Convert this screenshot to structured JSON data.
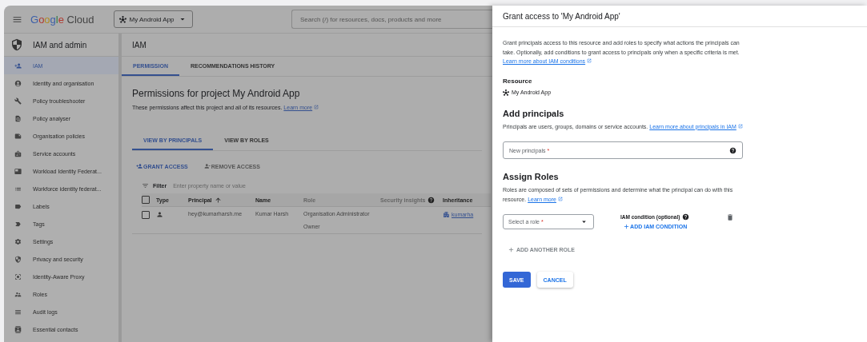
{
  "topbar": {
    "product": "Google Cloud",
    "project": "My Android App",
    "search": {
      "placeholder": "Search (/) for resources, docs, products and more"
    }
  },
  "sidebar": {
    "title": "IAM and admin",
    "items": [
      {
        "label": "IAM",
        "selected": true
      },
      {
        "label": "Identity and organisation",
        "selected": false
      },
      {
        "label": "Policy troubleshooter",
        "selected": false
      },
      {
        "label": "Policy analyser",
        "selected": false
      },
      {
        "label": "Organisation policies",
        "selected": false
      },
      {
        "label": "Service accounts",
        "selected": false
      },
      {
        "label": "Workload Identity Federat...",
        "selected": false
      },
      {
        "label": "Workforce identity federat...",
        "selected": false
      },
      {
        "label": "Labels",
        "selected": false
      },
      {
        "label": "Tags",
        "selected": false
      },
      {
        "label": "Settings",
        "selected": false
      },
      {
        "label": "Privacy and security",
        "selected": false
      },
      {
        "label": "Identity-Aware Proxy",
        "selected": false
      },
      {
        "label": "Roles",
        "selected": false
      },
      {
        "label": "Audit logs",
        "selected": false
      },
      {
        "label": "Essential contacts",
        "selected": false
      }
    ]
  },
  "main": {
    "title": "IAM",
    "tabs": [
      {
        "label": "PERMISSION",
        "selected": true
      },
      {
        "label": "RECOMMENDATIONS HISTORY",
        "selected": false
      }
    ],
    "heading": "Permissions for project My Android App",
    "description": "These permissions affect this project and all of its resources.",
    "learn_more": "Learn more",
    "view_tabs": [
      {
        "label": "VIEW BY PRINCIPALS",
        "selected": true
      },
      {
        "label": "VIEW BY ROLES",
        "selected": false
      }
    ],
    "actions": [
      {
        "label": "GRANT ACCESS",
        "disabled": false
      },
      {
        "label": "REMOVE ACCESS",
        "disabled": true
      }
    ],
    "filter": {
      "label": "Filter",
      "placeholder": "Enter property name or value"
    },
    "table": {
      "select_all": {
        "checked": false
      },
      "columns": [
        "Type",
        "Principal",
        "Name",
        "Role",
        "Security insights",
        "Inheritance"
      ],
      "rows": [
        {
          "checked": false,
          "principal": "hey@kumarharsh.me",
          "name": "Kumar Harsh",
          "roles": [
            "Organisation Administrator",
            "Owner"
          ],
          "inheritance": "kumarha"
        }
      ]
    }
  },
  "drawer": {
    "title": "Grant access to 'My Android App'",
    "intro": "Grant principals access to this resource and add roles to specify what actions the principals can take. Optionally, add conditions to grant access to principals only when a specific criteria is met.",
    "intro_link": "Learn more about IAM conditions",
    "resource": {
      "heading": "Resource",
      "name": "My Android App"
    },
    "principals": {
      "heading": "Add principals",
      "text": "Principals are users, groups, domains or service accounts.",
      "link": "Learn more about principals in IAM",
      "field": {
        "placeholder": "New principals",
        "required": "*"
      }
    },
    "roles": {
      "heading": "Assign Roles",
      "text": "Roles are composed of sets of permissions and determine what the principal can do with this resource.",
      "link": "Learn more",
      "select": {
        "placeholder": "Select a role",
        "required": "*"
      },
      "condition_label": "IAM condition (optional)",
      "add_condition": "ADD IAM CONDITION",
      "add_role": "ADD ANOTHER ROLE"
    },
    "buttons": [
      {
        "label": "SAVE",
        "kind": "primary"
      },
      {
        "label": "CANCEL",
        "kind": "secondary"
      }
    ]
  }
}
